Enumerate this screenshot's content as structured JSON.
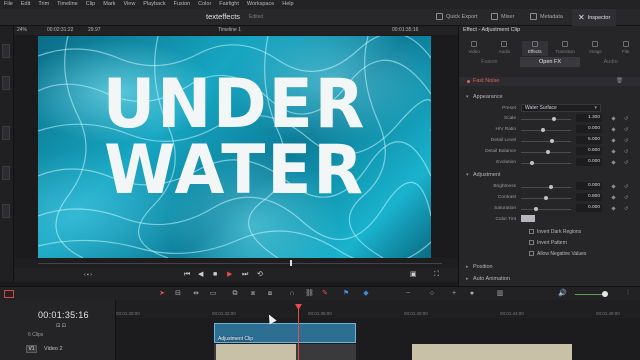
{
  "menu": [
    "File",
    "Edit",
    "Trim",
    "Timeline",
    "Clip",
    "Mark",
    "View",
    "Playback",
    "Fusion",
    "Color",
    "Fairlight",
    "Workspace",
    "Help"
  ],
  "project": {
    "name": "texteffects",
    "status": "Edited"
  },
  "header_buttons": {
    "quick_export": "Quick Export",
    "mixer": "Mixer",
    "metadata": "Metadata",
    "inspector": "Inspector"
  },
  "viewer": {
    "zoom": "24%",
    "source_tc": "00:02:31:22",
    "fps": "29.97",
    "timeline_name": "Timeline 1",
    "record_tc": "00:01:35:16",
    "overlay_line1": "UNDER",
    "overlay_line2": "WATER"
  },
  "inspector": {
    "title": "Effect - Adjustment Clip",
    "tabs": [
      "Video",
      "Audio",
      "Effects",
      "Transition",
      "Image",
      "File"
    ],
    "active_tab": "Effects",
    "subtabs": [
      "Fusion",
      "Open FX",
      "Audio"
    ],
    "active_subtab": "Open FX",
    "effect_name": "Fast Noise",
    "appearance_section": "Appearance",
    "adjustment_section": "Adjustment",
    "position_section": "Position",
    "animation_section": "Auto Animation",
    "preset_label": "Preset",
    "preset_value": "Water Surface",
    "params": [
      {
        "label": "Scale",
        "value": "1.300",
        "level": 0.66
      },
      {
        "label": "H/V Ratio",
        "value": "0.000",
        "level": 0.44
      },
      {
        "label": "Detail Level",
        "value": "5.000",
        "level": 0.62
      },
      {
        "label": "Detail Balance",
        "value": "0.600",
        "level": 0.54
      },
      {
        "label": "Evolution",
        "value": "0.000",
        "level": 0.22
      }
    ],
    "adjustments": [
      {
        "label": "Brightness",
        "value": "0.000",
        "level": 0.6
      },
      {
        "label": "Contrast",
        "value": "0.800",
        "level": 0.5
      },
      {
        "label": "Saturation",
        "value": "0.000",
        "level": 0.3
      }
    ],
    "color_tint_label": "Color Tint",
    "checkboxes": [
      "Invert Dark Regions",
      "Invert Pattern",
      "Allow Negative Values"
    ]
  },
  "timeline": {
    "timecode": "00:01:35:16",
    "ruler": [
      "00:01:28:00",
      "00:01:32:00",
      "00:01:36:00",
      "00:01:40:00",
      "00:01:44:00",
      "00:01:48:00"
    ],
    "track_clips": "6 Clips",
    "track_badge": "V1",
    "track_name": "Video 2",
    "adjustment_clip_label": "Adjustment Clip",
    "volume_level": 0.87
  },
  "colors": {
    "accent_red": "#e64b44",
    "clip_blue": "#2c6f93",
    "water": "#16a6c2"
  },
  "icons": [
    "gear-icon",
    "play-icon",
    "stop-icon",
    "prev-icon",
    "next-icon",
    "loop-icon",
    "keyframe-icon",
    "reset-icon",
    "snap-icon",
    "link-icon",
    "blade-icon",
    "flag-icon",
    "marker-icon",
    "speaker-icon",
    "checkbox-icon"
  ]
}
